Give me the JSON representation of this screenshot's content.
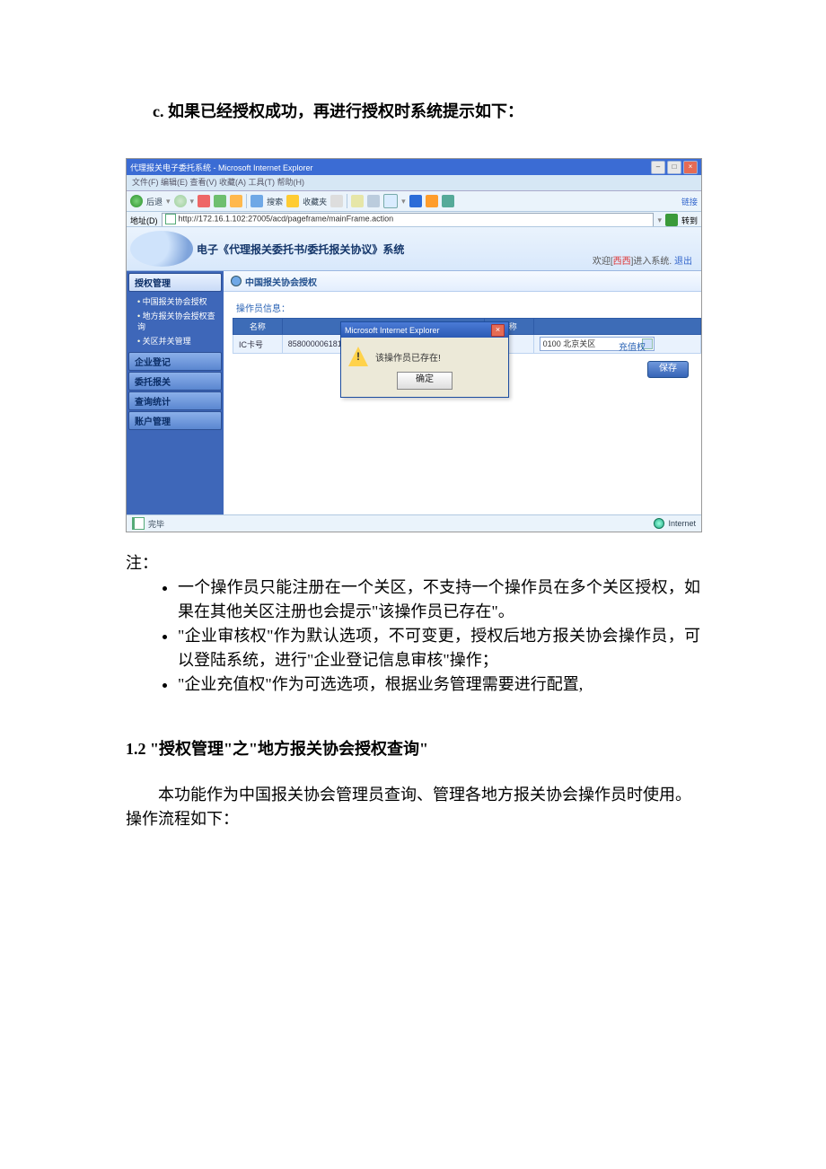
{
  "doc": {
    "section_c_prefix": "c. ",
    "section_c_text": "如果已经授权成功，再进行授权时系统提示如下：",
    "notes_head": "注：",
    "notes": [
      "一个操作员只能注册在一个关区，不支持一个操作员在多个关区授权，如果在其他关区注册也会提示\"该操作员已存在\"。",
      " \"企业审核权\"作为默认选项，不可变更，授权后地方报关协会操作员，可以登陆系统，进行\"企业登记信息审核\"操作；",
      " \"企业充值权\"作为可选选项，根据业务管理需要进行配置,"
    ],
    "sec12": "1.2  \"授权管理\"之\"地方报关协会授权查询\"",
    "para1": "本功能作为中国报关协会管理员查询、管理各地方报关协会操作员时使用。",
    "para2": "操作流程如下："
  },
  "ie": {
    "title": "代理报关电子委托系统 - Microsoft Internet Explorer",
    "menubar": "文件(F)  编辑(E)  查看(V)  收藏(A)  工具(T)  帮助(H)",
    "back_label": "后退",
    "search_label": "搜索",
    "fav_label": "收藏夹",
    "links_label": "链接",
    "addr_label": "地址(D)",
    "url": "http://172.16.1.102:27005/acd/pageframe/mainFrame.action",
    "go_label": "转到",
    "status_done": "完毕",
    "zone": "Internet"
  },
  "sys": {
    "title": "电子《代理报关委托书/委托报关协议》系统",
    "welcome_prefix": "欢迎[",
    "welcome_user": "西西",
    "welcome_suffix": "]进入系统. ",
    "logout": "退出"
  },
  "nav": {
    "h1": "授权管理",
    "items": [
      "中国报关协会授权",
      "地方报关协会授权查询",
      "关区并关管理"
    ],
    "h2": "企业登记",
    "h3": "委托报关",
    "h4": "查询统计",
    "h5": "账户管理"
  },
  "panel": {
    "title": "中国报关协会授权",
    "oper_info": "操作员信息：",
    "col_name1": "名称",
    "col_name2": "名称",
    "row_label": "IC卡号",
    "ic_value": "8580000061813",
    "select_value": "0100 北京关区",
    "right_label": "充值权",
    "save": "保存"
  },
  "dialog": {
    "title": "Microsoft Internet Explorer",
    "msg": "该操作员已存在!",
    "ok": "确定"
  }
}
